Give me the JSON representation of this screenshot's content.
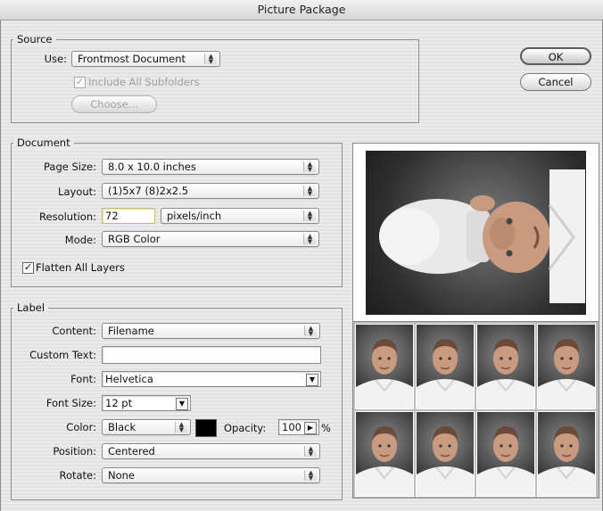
{
  "window": {
    "title": "Picture Package"
  },
  "buttons": {
    "ok": "OK",
    "cancel": "Cancel"
  },
  "source": {
    "legend": "Source",
    "use_label": "Use:",
    "use_value": "Frontmost Document",
    "include_subfolders_label": "Include All Subfolders",
    "include_subfolders_checked": true,
    "choose_label": "Choose..."
  },
  "document": {
    "legend": "Document",
    "page_size_label": "Page Size:",
    "page_size_value": "8.0 x 10.0 inches",
    "layout_label": "Layout:",
    "layout_value": "(1)5x7 (8)2x2.5",
    "resolution_label": "Resolution:",
    "resolution_value": "72",
    "resolution_unit": "pixels/inch",
    "mode_label": "Mode:",
    "mode_value": "RGB Color",
    "flatten_label": "Flatten All Layers",
    "flatten_checked": true
  },
  "label": {
    "legend": "Label",
    "content_label": "Content:",
    "content_value": "Filename",
    "custom_text_label": "Custom Text:",
    "custom_text_value": "",
    "font_label": "Font:",
    "font_value": "Helvetica",
    "font_size_label": "Font Size:",
    "font_size_value": "12 pt",
    "color_label": "Color:",
    "color_value": "Black",
    "color_swatch": "#000000",
    "opacity_label": "Opacity:",
    "opacity_value": "100",
    "opacity_unit": "%",
    "position_label": "Position:",
    "position_value": "Centered",
    "rotate_label": "Rotate:",
    "rotate_value": "None"
  },
  "icons": {
    "checkmark": "checkmark-icon",
    "popup_arrows": "updown-arrows-icon",
    "popup_down": "down-arrow-icon",
    "stepper_right": "right-arrow-icon"
  }
}
